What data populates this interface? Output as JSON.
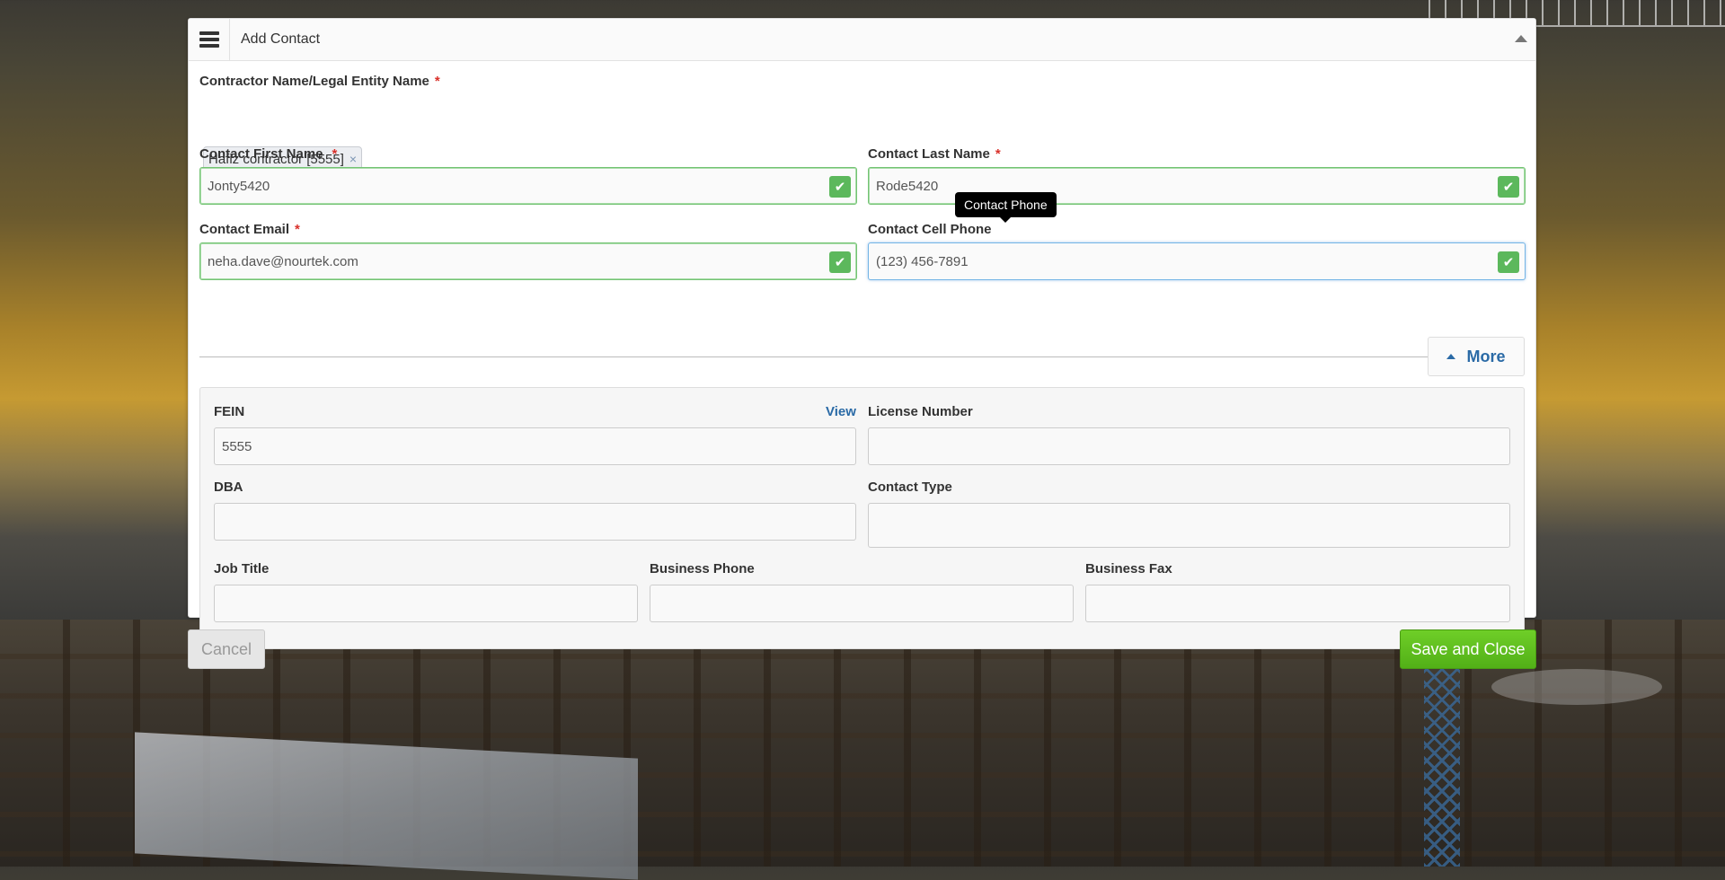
{
  "header": {
    "title": "Add Contact"
  },
  "contractor": {
    "label": "Contractor Name/Legal Entity Name",
    "required_mark": "*",
    "tag": "Hafiz contractor [5555]",
    "tag_remove": "×"
  },
  "first_name": {
    "label": "Contact First Name",
    "required_mark": "*",
    "value": "Jonty5420"
  },
  "last_name": {
    "label": "Contact Last Name",
    "required_mark": "*",
    "value": "Rode5420"
  },
  "email": {
    "label": "Contact Email",
    "required_mark": "*",
    "value": "neha.dave@nourtek.com"
  },
  "cell_phone": {
    "label": "Contact Cell Phone",
    "value": "(123) 456-7891",
    "tooltip": "Contact Phone"
  },
  "more_button": {
    "label": "More"
  },
  "more": {
    "fein": {
      "label": "FEIN",
      "value": "5555",
      "view_link": "View"
    },
    "license": {
      "label": "License Number",
      "value": ""
    },
    "dba": {
      "label": "DBA",
      "value": ""
    },
    "contact_type": {
      "label": "Contact Type",
      "value": ""
    },
    "job_title": {
      "label": "Job Title",
      "value": ""
    },
    "business_phone": {
      "label": "Business Phone",
      "value": ""
    },
    "business_fax": {
      "label": "Business Fax",
      "value": ""
    }
  },
  "footer": {
    "cancel_label": "Cancel",
    "save_label": "Save and Close"
  },
  "colors": {
    "accent": "#2a6aa6",
    "valid": "#5cb85c",
    "save": "#5bbf1d",
    "required": "#d9302a"
  },
  "icons": {
    "menu": "hamburger-icon",
    "collapse": "caret-up-icon",
    "valid": "check-icon",
    "more": "caret-up-icon"
  }
}
